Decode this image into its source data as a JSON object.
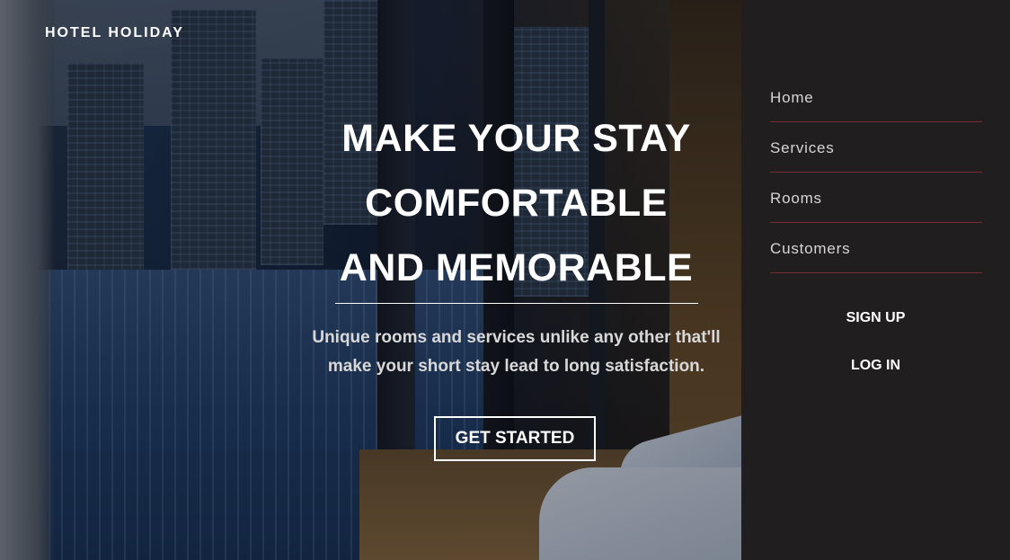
{
  "brand": "HOTEL HOLIDAY",
  "hero": {
    "headline_lines": [
      "MAKE YOUR STAY",
      "COMFORTABLE",
      "AND MEMORABLE"
    ],
    "subtitle_lines": [
      "Unique rooms and services unlike any other that'll",
      "make your short stay lead to long satisfaction."
    ],
    "cta_label": "GET STARTED"
  },
  "sidebar": {
    "nav": [
      {
        "label": "Home"
      },
      {
        "label": "Services"
      },
      {
        "label": "Rooms"
      },
      {
        "label": "Customers"
      }
    ],
    "signup_label": "SIGN UP",
    "login_label": "LOG IN"
  },
  "colors": {
    "sidebar_bg": "#201e1f",
    "nav_divider": "#7a2c36",
    "text_white": "#ffffff"
  }
}
